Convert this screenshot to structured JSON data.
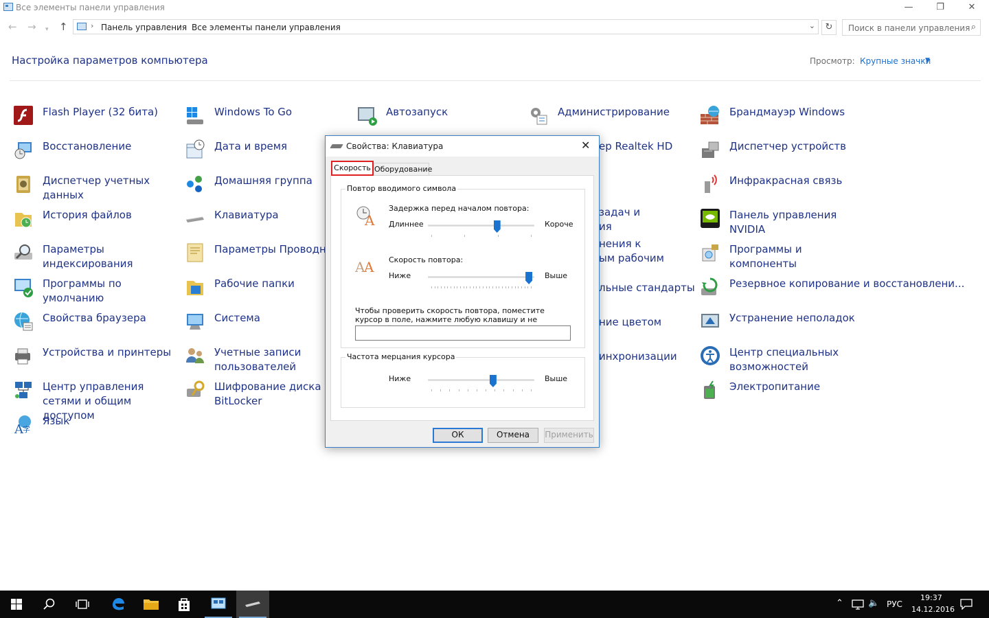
{
  "window": {
    "title": "Все элементы панели управления",
    "minimize_glyph": "—",
    "maximize_glyph": "❐",
    "close_glyph": "✕"
  },
  "address_bar": {
    "back_glyph": "←",
    "forward_glyph": "→",
    "recent_glyph": "▾",
    "up_glyph": "↑",
    "separator": "›",
    "crumbs": [
      "Панель управления",
      "Все элементы панели управления"
    ],
    "dropdown_glyph": "⌄",
    "refresh_glyph": "↻",
    "search_placeholder": "Поиск в панели управления",
    "search_glyph": "⌕"
  },
  "header": {
    "title": "Настройка параметров компьютера",
    "view_label": "Просмотр:",
    "view_value": "Крупные значки",
    "view_caret": "▼"
  },
  "items": [
    {
      "label": "Flash Player (32 бита)",
      "icon": "flash-player-icon"
    },
    {
      "label": "Восстановление",
      "icon": "recovery-icon"
    },
    {
      "label": "Диспетчер учетных данных",
      "icon": "credential-manager-icon"
    },
    {
      "label": "История файлов",
      "icon": "file-history-icon"
    },
    {
      "label": "Параметры индексирования",
      "icon": "indexing-options-icon"
    },
    {
      "label": "Программы по умолчанию",
      "icon": "default-programs-icon"
    },
    {
      "label": "Свойства браузера",
      "icon": "internet-options-icon"
    },
    {
      "label": "Устройства и принтеры",
      "icon": "devices-printers-icon"
    },
    {
      "label": "Центр управления сетями и общим доступом",
      "icon": "network-center-icon"
    },
    {
      "label": "Язык",
      "icon": "language-icon"
    },
    {
      "label": "Windows To Go",
      "icon": "windows-to-go-icon"
    },
    {
      "label": "Дата и время",
      "icon": "date-time-icon"
    },
    {
      "label": "Домашняя группа",
      "icon": "homegroup-icon"
    },
    {
      "label": "Клавиатура",
      "icon": "keyboard-icon"
    },
    {
      "label": "Параметры Проводника",
      "icon": "explorer-options-icon"
    },
    {
      "label": "Рабочие папки",
      "icon": "work-folders-icon"
    },
    {
      "label": "Система",
      "icon": "system-icon"
    },
    {
      "label": "Учетные записи пользователей",
      "icon": "user-accounts-icon"
    },
    {
      "label": "Шифрование диска BitLocker",
      "icon": "bitlocker-icon"
    },
    {
      "label": "Автозапуск",
      "icon": "autoplay-icon"
    },
    {
      "label": "Администрирование",
      "icon": "administrative-tools-icon"
    },
    {
      "label": "ер Realtek HD",
      "icon": ""
    },
    {
      "label": "задач и",
      "icon": ""
    },
    {
      "label": "ия",
      "icon": ""
    },
    {
      "label": "нения к",
      "icon": ""
    },
    {
      "label": "ым рабочим",
      "icon": ""
    },
    {
      "label": "льные стандарты",
      "icon": ""
    },
    {
      "label": "ние цветом",
      "icon": ""
    },
    {
      "label": "инхронизации",
      "icon": ""
    },
    {
      "label": "Брандмауэр Windows",
      "icon": "firewall-icon"
    },
    {
      "label": "Диспетчер устройств",
      "icon": "device-manager-icon"
    },
    {
      "label": "Инфракрасная связь",
      "icon": "infrared-icon"
    },
    {
      "label": "Панель управления NVIDIA",
      "icon": "nvidia-icon"
    },
    {
      "label": "Программы и компоненты",
      "icon": "programs-features-icon"
    },
    {
      "label": "Резервное копирование и восстановлени...",
      "icon": "backup-restore-icon"
    },
    {
      "label": "Устранение неполадок",
      "icon": "troubleshooting-icon"
    },
    {
      "label": "Центр специальных возможностей",
      "icon": "ease-of-access-icon"
    },
    {
      "label": "Электропитание",
      "icon": "power-options-icon"
    }
  ],
  "dialog": {
    "title": "Свойства: Клавиатура",
    "close_glyph": "✕",
    "tabs": [
      "Скорость",
      "Оборудование"
    ],
    "repeat_group": {
      "legend": "Повтор вводимого символа",
      "delay_label": "Задержка перед началом повтора:",
      "delay_min": "Длиннее",
      "delay_max": "Короче",
      "delay_value": 0.66,
      "rate_label": "Скорость повтора:",
      "rate_min": "Ниже",
      "rate_max": "Выше",
      "rate_value": 0.98,
      "test_hint": "Чтобы проверить скорость повтора, поместите курсор в поле, нажмите любую клавишу и не отпускайте ее:"
    },
    "blink_group": {
      "legend": "Частота мерцания курсора",
      "min": "Ниже",
      "max": "Выше",
      "value": 0.62
    },
    "buttons": {
      "ok": "ОК",
      "cancel": "Отмена",
      "apply": "Применить"
    }
  },
  "taskbar": {
    "tray_up_glyph": "⌃",
    "volume_glyph": "🔈",
    "language": "РУС",
    "time": "19:37",
    "date": "14.12.2016"
  }
}
